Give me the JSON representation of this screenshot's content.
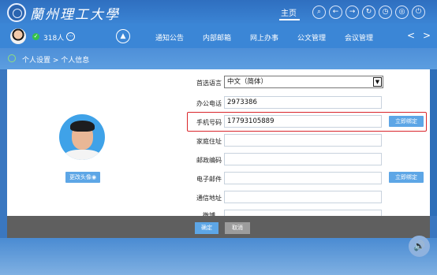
{
  "header": {
    "school_name": "蘭州理工大學",
    "home_label": "主页",
    "toolbar_icons": [
      "search-icon",
      "back-icon",
      "forward-icon",
      "refresh-icon",
      "clock-icon",
      "target-icon",
      "power-icon"
    ],
    "toolbar_glyphs": [
      "⌕",
      "←",
      "→",
      "↻",
      "◷",
      "◎",
      "⏻"
    ]
  },
  "nav": {
    "online_count": "318人",
    "more_glyph": "···",
    "up_glyph": "▲",
    "items": [
      "通知公告",
      "内部邮箱",
      "网上办事",
      "公文管理",
      "会议管理"
    ],
    "prev_glyph": "<",
    "next_glyph": ">"
  },
  "breadcrumb": "个人设置 > 个人信息",
  "profile": {
    "change_avatar_label": "更改头像"
  },
  "form": {
    "language_label": "首选语言",
    "language_value": "中文（简体）",
    "office_phone_label": "办公电话",
    "office_phone_value": "2973386",
    "mobile_label": "手机号码",
    "mobile_value": "17793105889",
    "bind_now_label": "立即绑定",
    "home_address_label": "家庭住址",
    "home_address_value": "",
    "postcode_label": "邮政编码",
    "postcode_value": "",
    "email_label": "电子邮件",
    "email_value": "",
    "mail_address_label": "通信地址",
    "mail_address_value": "",
    "partial_label": "微博"
  },
  "actions": {
    "confirm_label": "确定",
    "cancel_label": "取消"
  },
  "colors": {
    "accent": "#3b86d6",
    "highlight_border": "#d9262b",
    "button_blue": "#5da6e6"
  }
}
